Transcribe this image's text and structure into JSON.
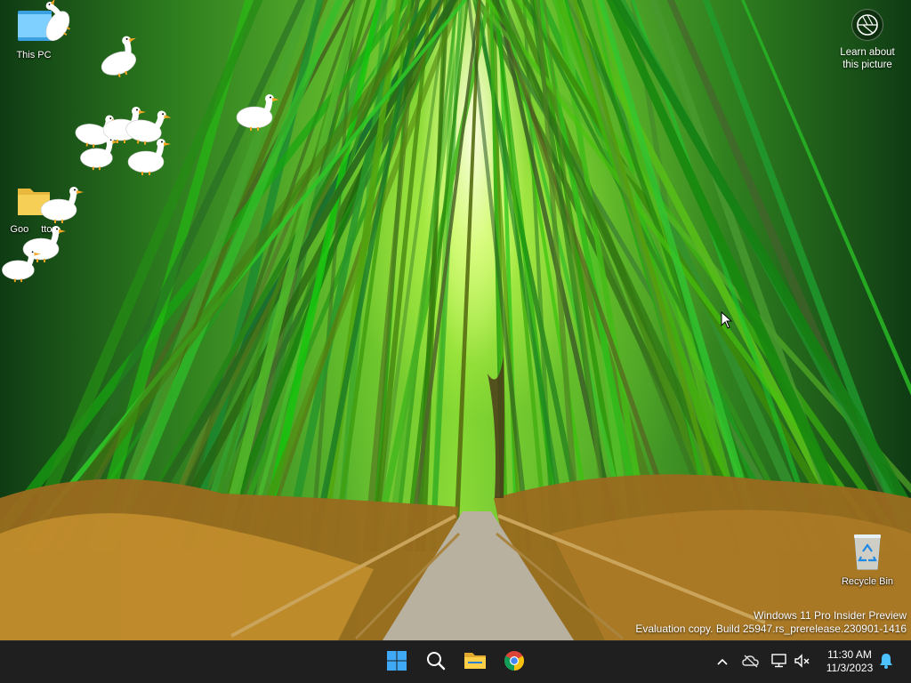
{
  "desktop": {
    "icons": [
      {
        "label": "This PC",
        "icon": "this-pc-icon"
      },
      {
        "label": "Goose Desktop",
        "icon": "folder-icon"
      },
      {
        "label": "Recycle Bin",
        "icon": "recycle-bin-icon"
      }
    ],
    "goose_label_fragment": "ttop",
    "goose_label_prefix": "Goo"
  },
  "spotlight": {
    "label_line1": "Learn about",
    "label_line2": "this picture",
    "icon": "camera-aperture-icon"
  },
  "watermark": {
    "line1": "Windows 11 Pro Insider Preview",
    "line2": "Evaluation copy. Build 25947.rs_prerelease.230901-1416"
  },
  "taskbar": {
    "apps": [
      {
        "name": "Start",
        "icon": "windows-logo-icon"
      },
      {
        "name": "Search",
        "icon": "search-icon"
      },
      {
        "name": "File Explorer",
        "icon": "file-explorer-icon"
      },
      {
        "name": "Google Chrome",
        "icon": "chrome-icon"
      }
    ],
    "tray": {
      "chevron": "chevron-up-icon",
      "onedrive": "onedrive-offline-icon",
      "network": "network-icon",
      "volume": "volume-muted-icon",
      "notifications": "bell-icon"
    },
    "clock": {
      "time": "11:30 AM",
      "date": "11/3/2023"
    }
  },
  "colors": {
    "taskbar_bg": "#1f1f1f",
    "accent": "#0078d4",
    "bamboo_green": "#4caf2a",
    "dry_grass": "#b8862c"
  }
}
